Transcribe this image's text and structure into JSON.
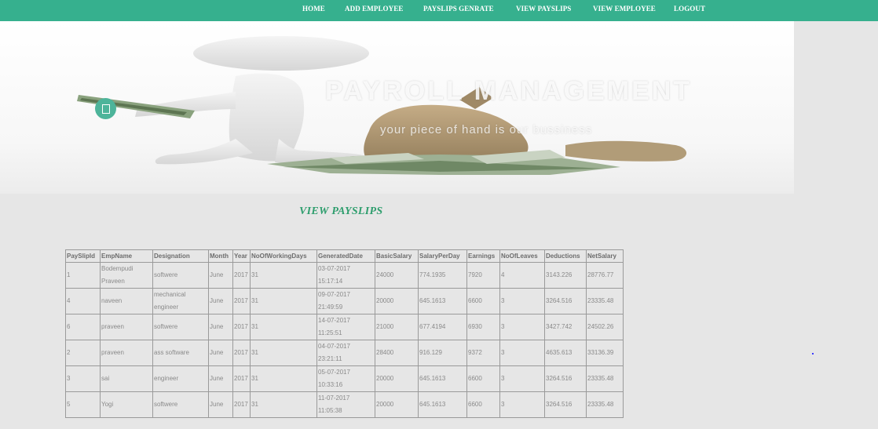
{
  "nav": {
    "items": [
      "HOME",
      "ADD EMPLOYEE",
      "PAYSLIPS GENRATE",
      "VIEW PAYSLIPS",
      "VIEW EMPLOYEE",
      "LOGOUT"
    ]
  },
  "banner": {
    "title": "PAYROLL MANAGEMENT",
    "subtitle": "your piece of hand is our bussiness"
  },
  "page": {
    "heading": "VIEW PAYSLIPS"
  },
  "table": {
    "headers": [
      "PaySlipId",
      "EmpName",
      "Designation",
      "Month",
      "Year",
      "NoOfWorkingDays",
      "GeneratedDate",
      "BasicSalary",
      "SalaryPerDay",
      "Earnings",
      "NoOfLeaves",
      "Deductions",
      "NetSalary"
    ],
    "rows": [
      [
        "1",
        "Bodempudi Praveen",
        "softwere",
        "June",
        "2017",
        "31",
        "03-07-2017 15:17:14",
        "24000",
        "774.1935",
        "7920",
        "4",
        "3143.226",
        "28776.77"
      ],
      [
        "4",
        "naveen",
        "mechanical engineer",
        "June",
        "2017",
        "31",
        "09-07-2017 21:49:59",
        "20000",
        "645.1613",
        "6600",
        "3",
        "3264.516",
        "23335.48"
      ],
      [
        "6",
        "praveen",
        "softwere",
        "June",
        "2017",
        "31",
        "14-07-2017 11:25:51",
        "21000",
        "677.4194",
        "6930",
        "3",
        "3427.742",
        "24502.26"
      ],
      [
        "2",
        "praveen",
        "ass software",
        "June",
        "2017",
        "31",
        "04-07-2017 23:21:11",
        "28400",
        "916.129",
        "9372",
        "3",
        "4635.613",
        "33136.39"
      ],
      [
        "3",
        "sai",
        "engineer",
        "June",
        "2017",
        "31",
        "05-07-2017 10:33:16",
        "20000",
        "645.1613",
        "6600",
        "3",
        "3264.516",
        "23335.48"
      ],
      [
        "5",
        "Yogi",
        "softwere",
        "June",
        "2017",
        "31",
        "11-07-2017 11:05:38",
        "20000",
        "645.1613",
        "6600",
        "3",
        "3264.516",
        "23335.48"
      ]
    ]
  },
  "colors": {
    "navbar": "#36b08e",
    "accent": "#2f9e6e",
    "page_background": "#e6e6e6"
  }
}
